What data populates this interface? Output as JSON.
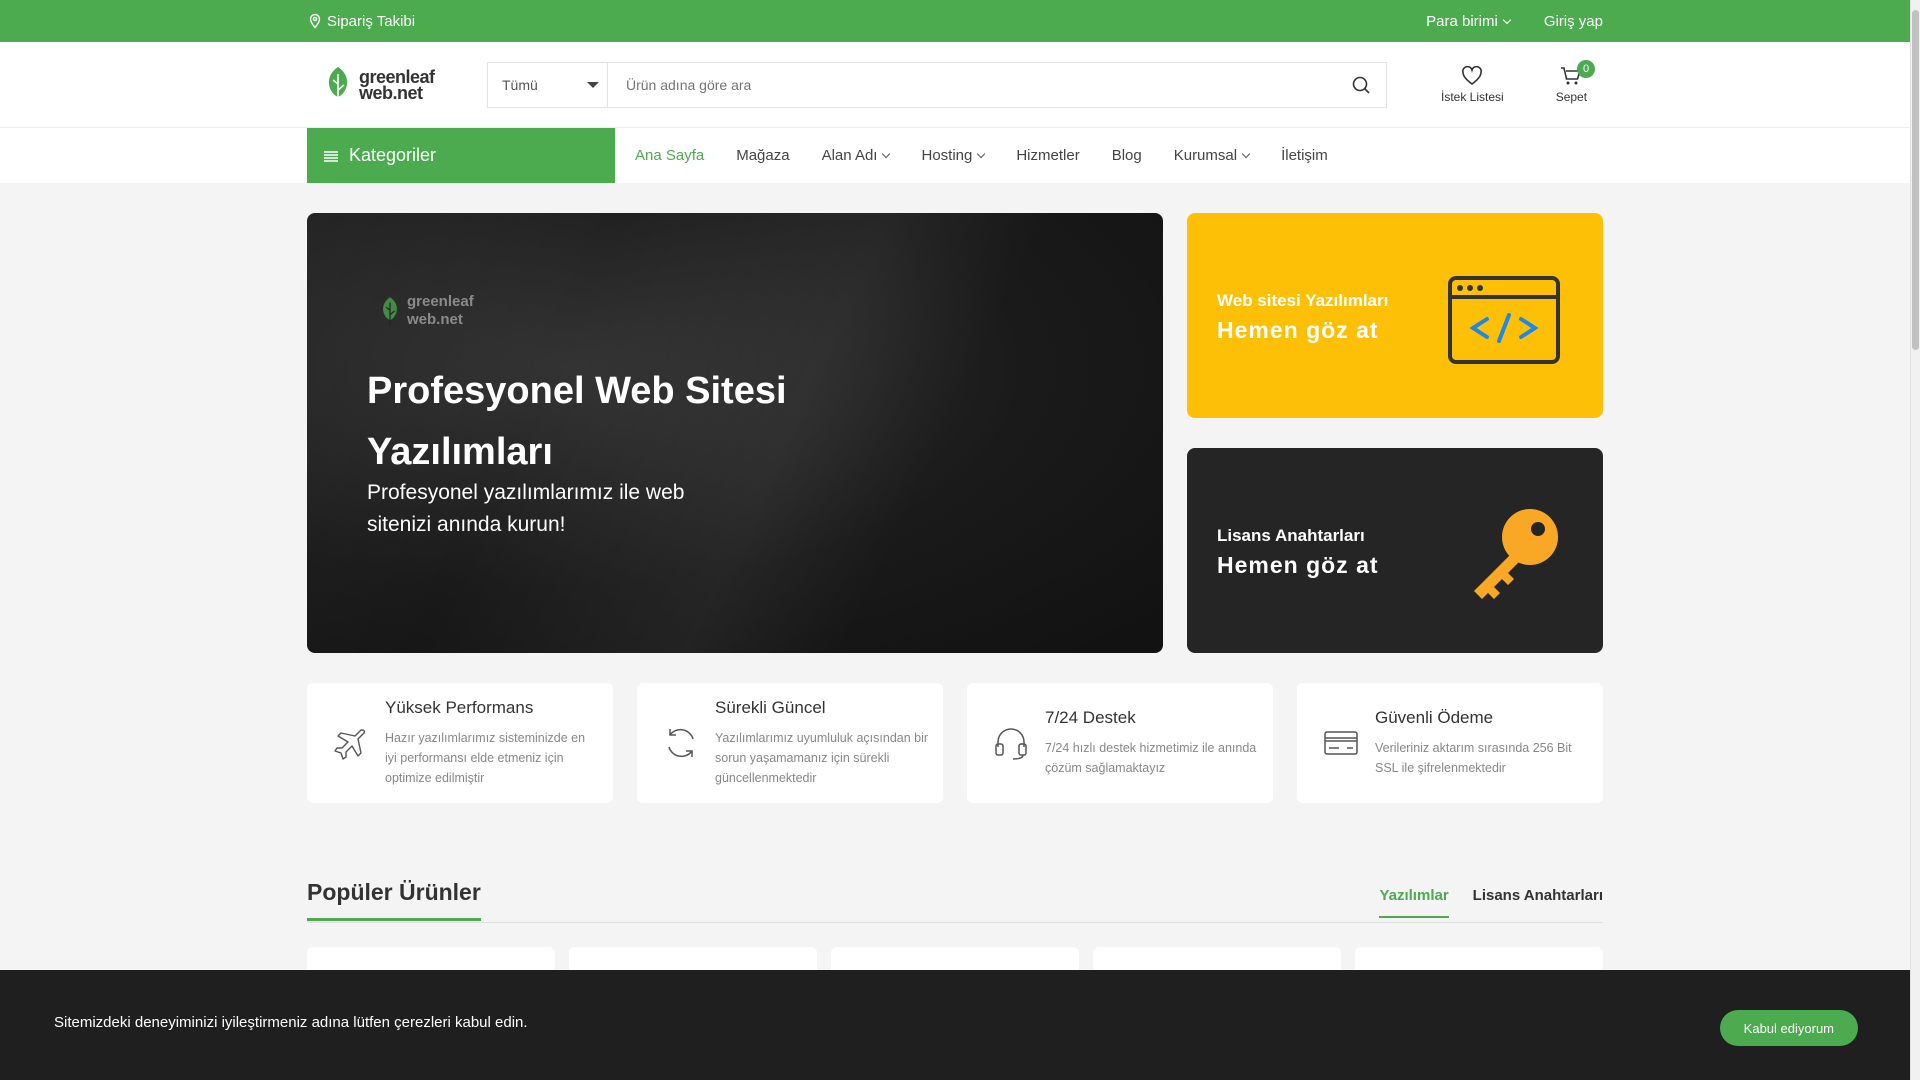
{
  "topbar": {
    "order_tracking": "Sipariş Takibi",
    "currency": "Para birimi",
    "login": "Giriş yap"
  },
  "header": {
    "logo_line1": "greenleaf",
    "logo_line2": "web.net",
    "category_select": "Tümü",
    "search_placeholder": "Ürün adına göre ara",
    "wishlist": "İstek Listesi",
    "cart": "Sepet",
    "cart_count": "0"
  },
  "nav": {
    "categories": "Kategoriler",
    "items": [
      {
        "label": "Ana Sayfa"
      },
      {
        "label": "Mağaza"
      },
      {
        "label": "Alan Adı"
      },
      {
        "label": "Hosting"
      },
      {
        "label": "Hizmetler"
      },
      {
        "label": "Blog"
      },
      {
        "label": "Kurumsal"
      },
      {
        "label": "İletişim"
      }
    ]
  },
  "hero": {
    "logo_line1": "greenleaf",
    "logo_line2": "web.net",
    "title": "Profesyonel Web Sitesi Yazılımları",
    "subtitle": "Profesyonel yazılımlarımız ile web sitenizi anında kurun!"
  },
  "promos": [
    {
      "title": "Web sitesi Yazılımları",
      "link": "Hemen göz at",
      "color": "#fec006"
    },
    {
      "title": "Lisans Anahtarları",
      "link": "Hemen göz at",
      "color": "#252525"
    }
  ],
  "features": [
    {
      "title": "Yüksek Performans",
      "text": "Hazır yazılımlarımız sisteminizde en iyi performansı elde etmeniz için optimize edilmiştir",
      "icon": "airplane-icon"
    },
    {
      "title": "Sürekli Güncel",
      "text": "Yazılımlarımız uyumluluk açısından bir sorun yaşamamanız için sürekli güncellenmektedir",
      "icon": "refresh-icon"
    },
    {
      "title": "7/24 Destek",
      "text": "7/24 hızlı destek hizmetimiz ile anında çözüm sağlamaktayız",
      "icon": "headset-icon"
    },
    {
      "title": "Güvenli Ödeme",
      "text": "Verileriniz aktarım sırasında 256 Bit SSL ile şifrelenmektedir",
      "icon": "credit-card-icon"
    }
  ],
  "popular": {
    "title": "Popüler Ürünler",
    "tabs": [
      {
        "label": "Yazılımlar"
      },
      {
        "label": "Lisans Anahtarları"
      }
    ]
  },
  "cookie": {
    "text": "Sitemizdeki deneyiminizi iyileştirmeniz adına lütfen çerezleri kabul edin.",
    "accept": "Kabul ediyorum"
  },
  "colors": {
    "brand": "#4caa4f",
    "yellow": "#fec006",
    "dark": "#252525"
  }
}
